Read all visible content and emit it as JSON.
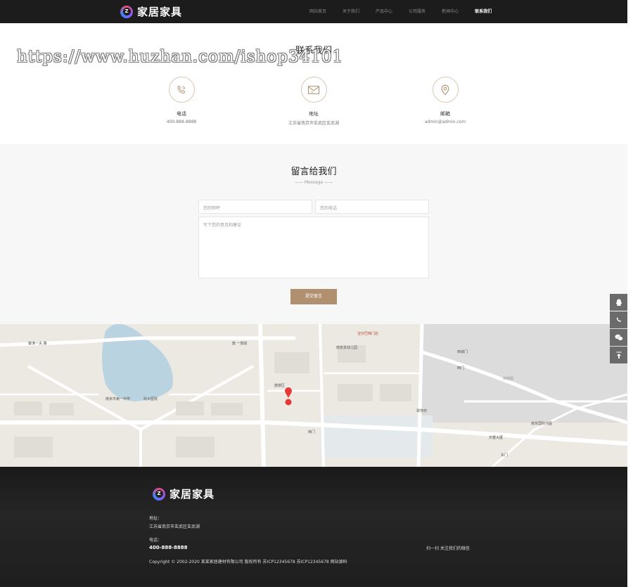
{
  "header": {
    "logo_badge": "Z",
    "logo_text": "家居家具",
    "nav": [
      {
        "label": "网站首页",
        "active": false
      },
      {
        "label": "关于我们",
        "active": false
      },
      {
        "label": "产品中心",
        "active": false
      },
      {
        "label": "公司服务",
        "active": false
      },
      {
        "label": "新闻中心",
        "active": false
      },
      {
        "label": "联系我们",
        "active": true
      }
    ]
  },
  "watermark": "https://www.huzhan.com/ishop34101",
  "contact": {
    "title": "联系我们",
    "items": [
      {
        "icon": "phone-icon",
        "label": "电话",
        "value": "400-888-8888"
      },
      {
        "icon": "mail-icon",
        "label": "地址",
        "value": "江苏省南京市玄武区玄武湖"
      },
      {
        "icon": "location-icon",
        "label": "邮箱",
        "value": "admin@admin.com"
      }
    ]
  },
  "message": {
    "title": "留言给我们",
    "subtitle": "—— Message ——",
    "name_placeholder": "您的称呼",
    "phone_placeholder": "您的电话",
    "content_placeholder": "写下您的意见和建议",
    "submit_label": "提交留言"
  },
  "map": {
    "labels": [
      {
        "text": "秦淮一夫 路"
      },
      {
        "text": "鼓 一鼓前"
      },
      {
        "text": "宝仔巴西门店"
      },
      {
        "text": "南京多幼儿园"
      },
      {
        "text": "西城门"
      },
      {
        "text": "西门"
      },
      {
        "text": "钟鼓图"
      },
      {
        "text": "南京市第一中学"
      },
      {
        "text": "科大医院"
      },
      {
        "text": "鼓楼区"
      },
      {
        "text": "西门"
      },
      {
        "text": "南京国际河图"
      },
      {
        "text": "天璽大厦"
      },
      {
        "text": "东门"
      },
      {
        "text": "翠芳府"
      }
    ]
  },
  "side_buttons": [
    {
      "icon": "qq-icon"
    },
    {
      "icon": "phone-icon"
    },
    {
      "icon": "wechat-icon"
    },
    {
      "icon": "back-to-top-icon"
    }
  ],
  "footer": {
    "logo_text": "家居家具",
    "address_label": "地址：",
    "address": "江苏省南京市玄武区玄武湖",
    "phone_label": "电话：",
    "phone": "400-888-8888",
    "copyright": "Copyright © 2002-2020 某某家居建材有限公司 版权所有 苏ICP12345678 苏ICP12345678 网站源码",
    "qr_caption": "扫一扫 关注我们的微信"
  },
  "colors": {
    "header_bg": "#1c1c1c",
    "accent": "#b0906f",
    "marker": "#e53935"
  }
}
